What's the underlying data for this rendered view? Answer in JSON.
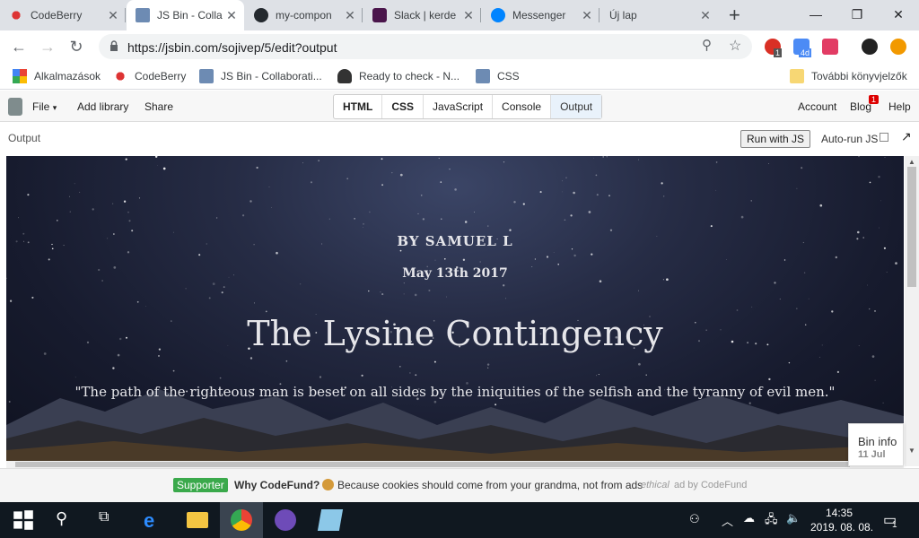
{
  "browser": {
    "tabs": [
      {
        "title": "CodeBerry",
        "active": false
      },
      {
        "title": "JS Bin - Colla",
        "active": true
      },
      {
        "title": "my-compon",
        "active": false
      },
      {
        "title": "Slack | kerde",
        "active": false
      },
      {
        "title": "Messenger",
        "active": false
      },
      {
        "title": "Új lap",
        "active": false
      }
    ],
    "new_tab": "+",
    "url": "https://jsbin.com/sojivep/5/edit?output",
    "bookmarks": [
      {
        "label": "Alkalmazások"
      },
      {
        "label": "CodeBerry"
      },
      {
        "label": "JS Bin - Collaborati..."
      },
      {
        "label": "Ready to check - N..."
      },
      {
        "label": "CSS"
      }
    ],
    "other_bookmarks": "További könyvjelzők",
    "ext_badges": [
      "1",
      "4d"
    ]
  },
  "jsbin": {
    "menu": [
      "File",
      "Add library",
      "Share"
    ],
    "file_caret": "▾",
    "panels": [
      "HTML",
      "CSS",
      "JavaScript",
      "Console",
      "Output"
    ],
    "right_links": [
      "Account",
      "Blog",
      "Help"
    ],
    "blog_badge": "1",
    "output_label": "Output",
    "run_button": "Run with JS",
    "autorun_label": "Auto-run JS",
    "bin_info": {
      "label": "Bin info",
      "date": "11 Jul"
    }
  },
  "page": {
    "byline": "BY SAMUEL L",
    "date": "May 13th 2017",
    "title": "The Lysine Contingency",
    "quote": "\"The path of the righteous man is beset on all sides by the iniquities of the selfish and the tyranny of evil men.\""
  },
  "codefund": {
    "badge": "Supporter",
    "headline": "Why CodeFund?",
    "text": "Because cookies should come from your grandma, not from ads",
    "ethical": "ethical",
    "ad_by": "ad by CodeFund"
  },
  "taskbar": {
    "time": "14:35",
    "date": "2019. 08. 08.",
    "notif_count": "1"
  }
}
